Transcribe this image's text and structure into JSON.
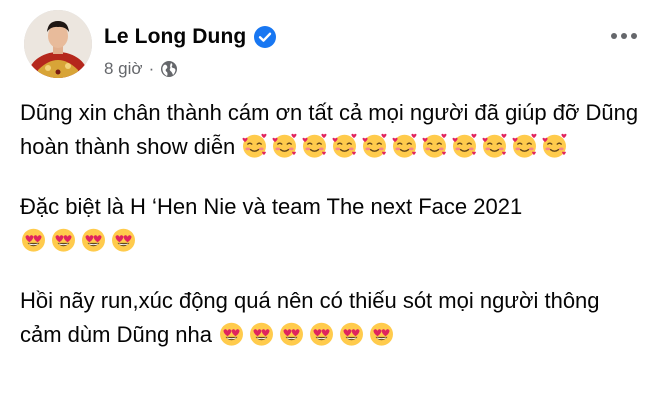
{
  "post": {
    "author": "Le Long Dung",
    "time": "8 giờ",
    "separator": "·",
    "privacy_icon": "globe-icon",
    "verified_icon": "verified-badge-icon",
    "more_icon": "more-options-icon",
    "colors": {
      "verified": "#1877f2",
      "meta": "#65676b",
      "text": "#050505"
    },
    "paragraphs": [
      {
        "text": "Dũng xin chân thành cám ơn tất cả mọi người đã giúp đỡ Dũng hoàn thành show diễn",
        "emoji": "smiling-face-with-hearts",
        "emoji_count": 11
      },
      {
        "text": "Đặc biệt là H ‘Hen Nie và team The next Face 2021",
        "emoji": "heart-eyes",
        "emoji_count": 4
      },
      {
        "text": "Hồi nãy run,xúc động quá nên có thiếu sót mọi người thông cảm dùm Dũng nha",
        "emoji": "heart-eyes",
        "emoji_count": 6
      }
    ]
  }
}
